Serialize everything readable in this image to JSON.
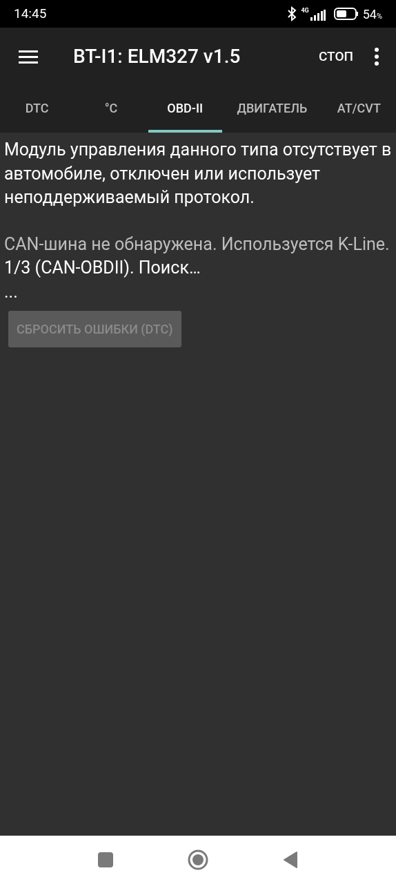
{
  "status_bar": {
    "time": "14:45",
    "network": "4G",
    "battery": "54",
    "battery_unit": "%"
  },
  "toolbar": {
    "title": "BT-I1: ELM327 v1.5",
    "action": "СТОП"
  },
  "tabs": [
    {
      "label": "DTC",
      "selected": false
    },
    {
      "label": "°C",
      "selected": false
    },
    {
      "label": "OBD-II",
      "selected": true
    },
    {
      "label": "ДВИГАТЕЛЬ",
      "selected": false
    },
    {
      "label": "AT/CVT",
      "selected": false
    }
  ],
  "messages": [
    {
      "kind": "primary",
      "text": "Модуль управления данного типа отсутствует в автомобиле, отключен или использует неподдерживаемый протокол."
    },
    {
      "kind": "gap"
    },
    {
      "kind": "secondary",
      "text": "CAN-шина не обнаружена. Используется K-Line."
    },
    {
      "kind": "primary",
      "text": "1/3 (CAN-OBDII). Поиск…"
    },
    {
      "kind": "primary",
      "text": "..."
    }
  ],
  "reset_button": {
    "label": "СБРОСИТЬ ОШИБКИ (DTC)",
    "disabled": true
  }
}
